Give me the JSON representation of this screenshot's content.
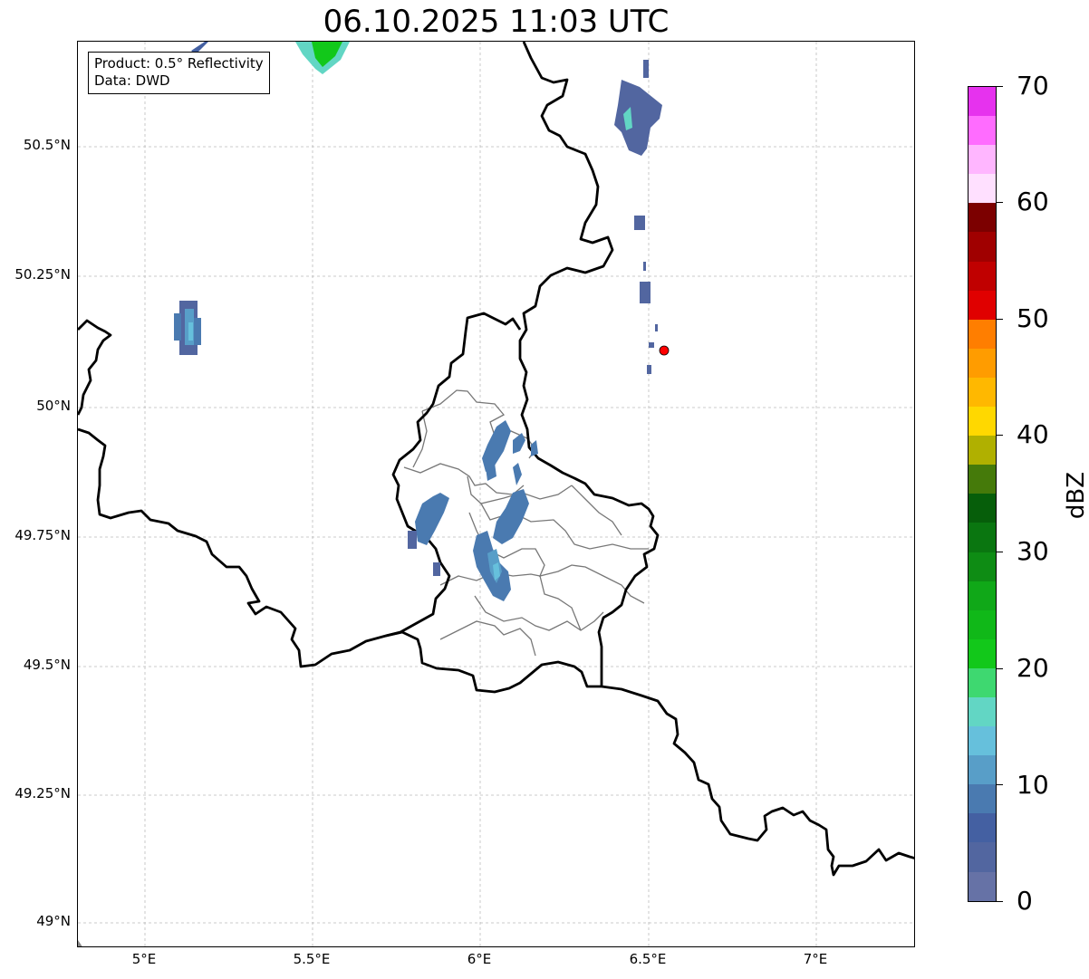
{
  "title": "06.10.2025 11:03 UTC",
  "info_box": {
    "product": "Product: 0.5° Reflectivity",
    "data": "Data: DWD"
  },
  "lat_labels": [
    "50.5°N",
    "50.25°N",
    "50°N",
    "49.75°N",
    "49.5°N",
    "49.25°N",
    "49°N"
  ],
  "lon_labels": [
    "5°E",
    "5.5°E",
    "6°E",
    "6.5°E",
    "7°E"
  ],
  "colorbar": {
    "label": "dBZ",
    "tick_labels": [
      "0",
      "10",
      "20",
      "30",
      "40",
      "50",
      "60",
      "70"
    ],
    "colors": [
      "#6672a6",
      "#5266a0",
      "#4460a2",
      "#4a7ab0",
      "#589ec8",
      "#66c0dc",
      "#62d6c4",
      "#3ed870",
      "#12c81a",
      "#10b818",
      "#10a818",
      "#0e8c14",
      "#0a7610",
      "#065e0a",
      "#457a0a",
      "#b0b000",
      "#ffd800",
      "#ffb800",
      "#ff9c00",
      "#ff7e00",
      "#e00000",
      "#c00000",
      "#a00000",
      "#7c0000",
      "#ffe0ff",
      "#ffb6ff",
      "#ff6cff",
      "#e632ee"
    ]
  },
  "map": {
    "lon_range": [
      4.8,
      7.3
    ],
    "lat_range": [
      48.95,
      50.7
    ],
    "marker": {
      "lon": 6.55,
      "lat": 50.11,
      "color": "#ff0000"
    }
  }
}
